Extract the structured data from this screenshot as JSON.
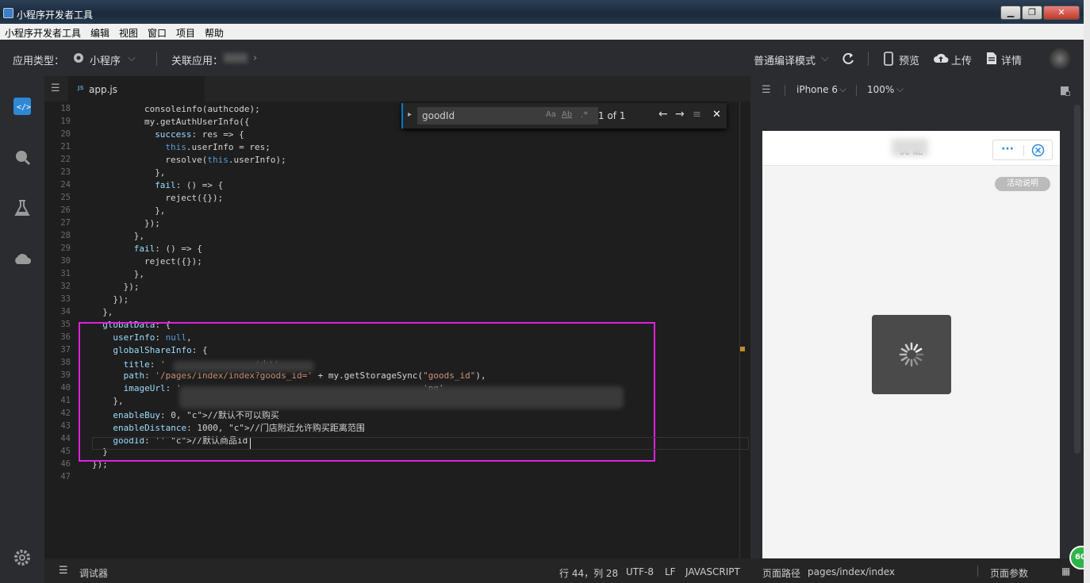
{
  "window": {
    "title": "小程序开发者工具"
  },
  "menu": [
    "小程序开发者工具",
    "编辑",
    "视图",
    "窗口",
    "项目",
    "帮助"
  ],
  "toolbar": {
    "app_type_label": "应用类型：",
    "app_type_value": "小程序",
    "related_app_label": "关联应用：",
    "compile_mode": "普通编译模式",
    "preview": "预览",
    "upload": "上传",
    "details": "详情"
  },
  "editor": {
    "tab": "app.js",
    "find": {
      "query": "goodId",
      "result": "1 of 1"
    },
    "lines": [
      {
        "n": "18",
        "code": "consoleinfo(authcode);"
      },
      {
        "n": "19",
        "code": "my.getAuthUserInfo({"
      },
      {
        "n": "20",
        "code": "success: res => {"
      },
      {
        "n": "21",
        "code": "this.userInfo = res;"
      },
      {
        "n": "22",
        "code": "resolve(this.userInfo);"
      },
      {
        "n": "23",
        "code": "},"
      },
      {
        "n": "24",
        "code": "fail: () => {"
      },
      {
        "n": "25",
        "code": "reject({});"
      },
      {
        "n": "26",
        "code": "},"
      },
      {
        "n": "27",
        "code": "});"
      },
      {
        "n": "28",
        "code": "},"
      },
      {
        "n": "29",
        "code": "fail: () => {"
      },
      {
        "n": "30",
        "code": "reject({});"
      },
      {
        "n": "31",
        "code": "},"
      },
      {
        "n": "32",
        "code": "});"
      },
      {
        "n": "33",
        "code": "});"
      },
      {
        "n": "34",
        "code": "},"
      },
      {
        "n": "35",
        "code": "globalData: {"
      },
      {
        "n": "36",
        "code": "userInfo: null,"
      },
      {
        "n": "37",
        "code": "globalShareInfo: {"
      },
      {
        "n": "38",
        "code": "title: '                 (小)',"
      },
      {
        "n": "39",
        "code": "path: '/pages/index/index?goods_id=' + my.getStorageSync(\"goods_id\"),"
      },
      {
        "n": "40",
        "code": "imageUrl: '                                              'pg'"
      },
      {
        "n": "41",
        "code": "},"
      },
      {
        "n": "42",
        "code": "enableBuy: 0, //默认不可以购买"
      },
      {
        "n": "43",
        "code": "enableDistance: 1000, //门店附近允许购买距离范围"
      },
      {
        "n": "44",
        "code": "goodId: '' //默认商品id"
      },
      {
        "n": "45",
        "code": "}"
      },
      {
        "n": "46",
        "code": "});"
      },
      {
        "n": "47",
        "code": ""
      }
    ]
  },
  "simulator": {
    "device": "iPhone 6",
    "zoom": "100%",
    "page_title": "优  能",
    "activity_btn": "活动说明"
  },
  "status": {
    "debugger": "调试器",
    "position": "行 44，列 28",
    "encoding": "UTF-8",
    "eol": "LF",
    "language": "JAVASCRIPT",
    "page_path_label": "页面路径",
    "page_path": "pages/index/index",
    "page_params": "页面参数",
    "badge": "60"
  }
}
